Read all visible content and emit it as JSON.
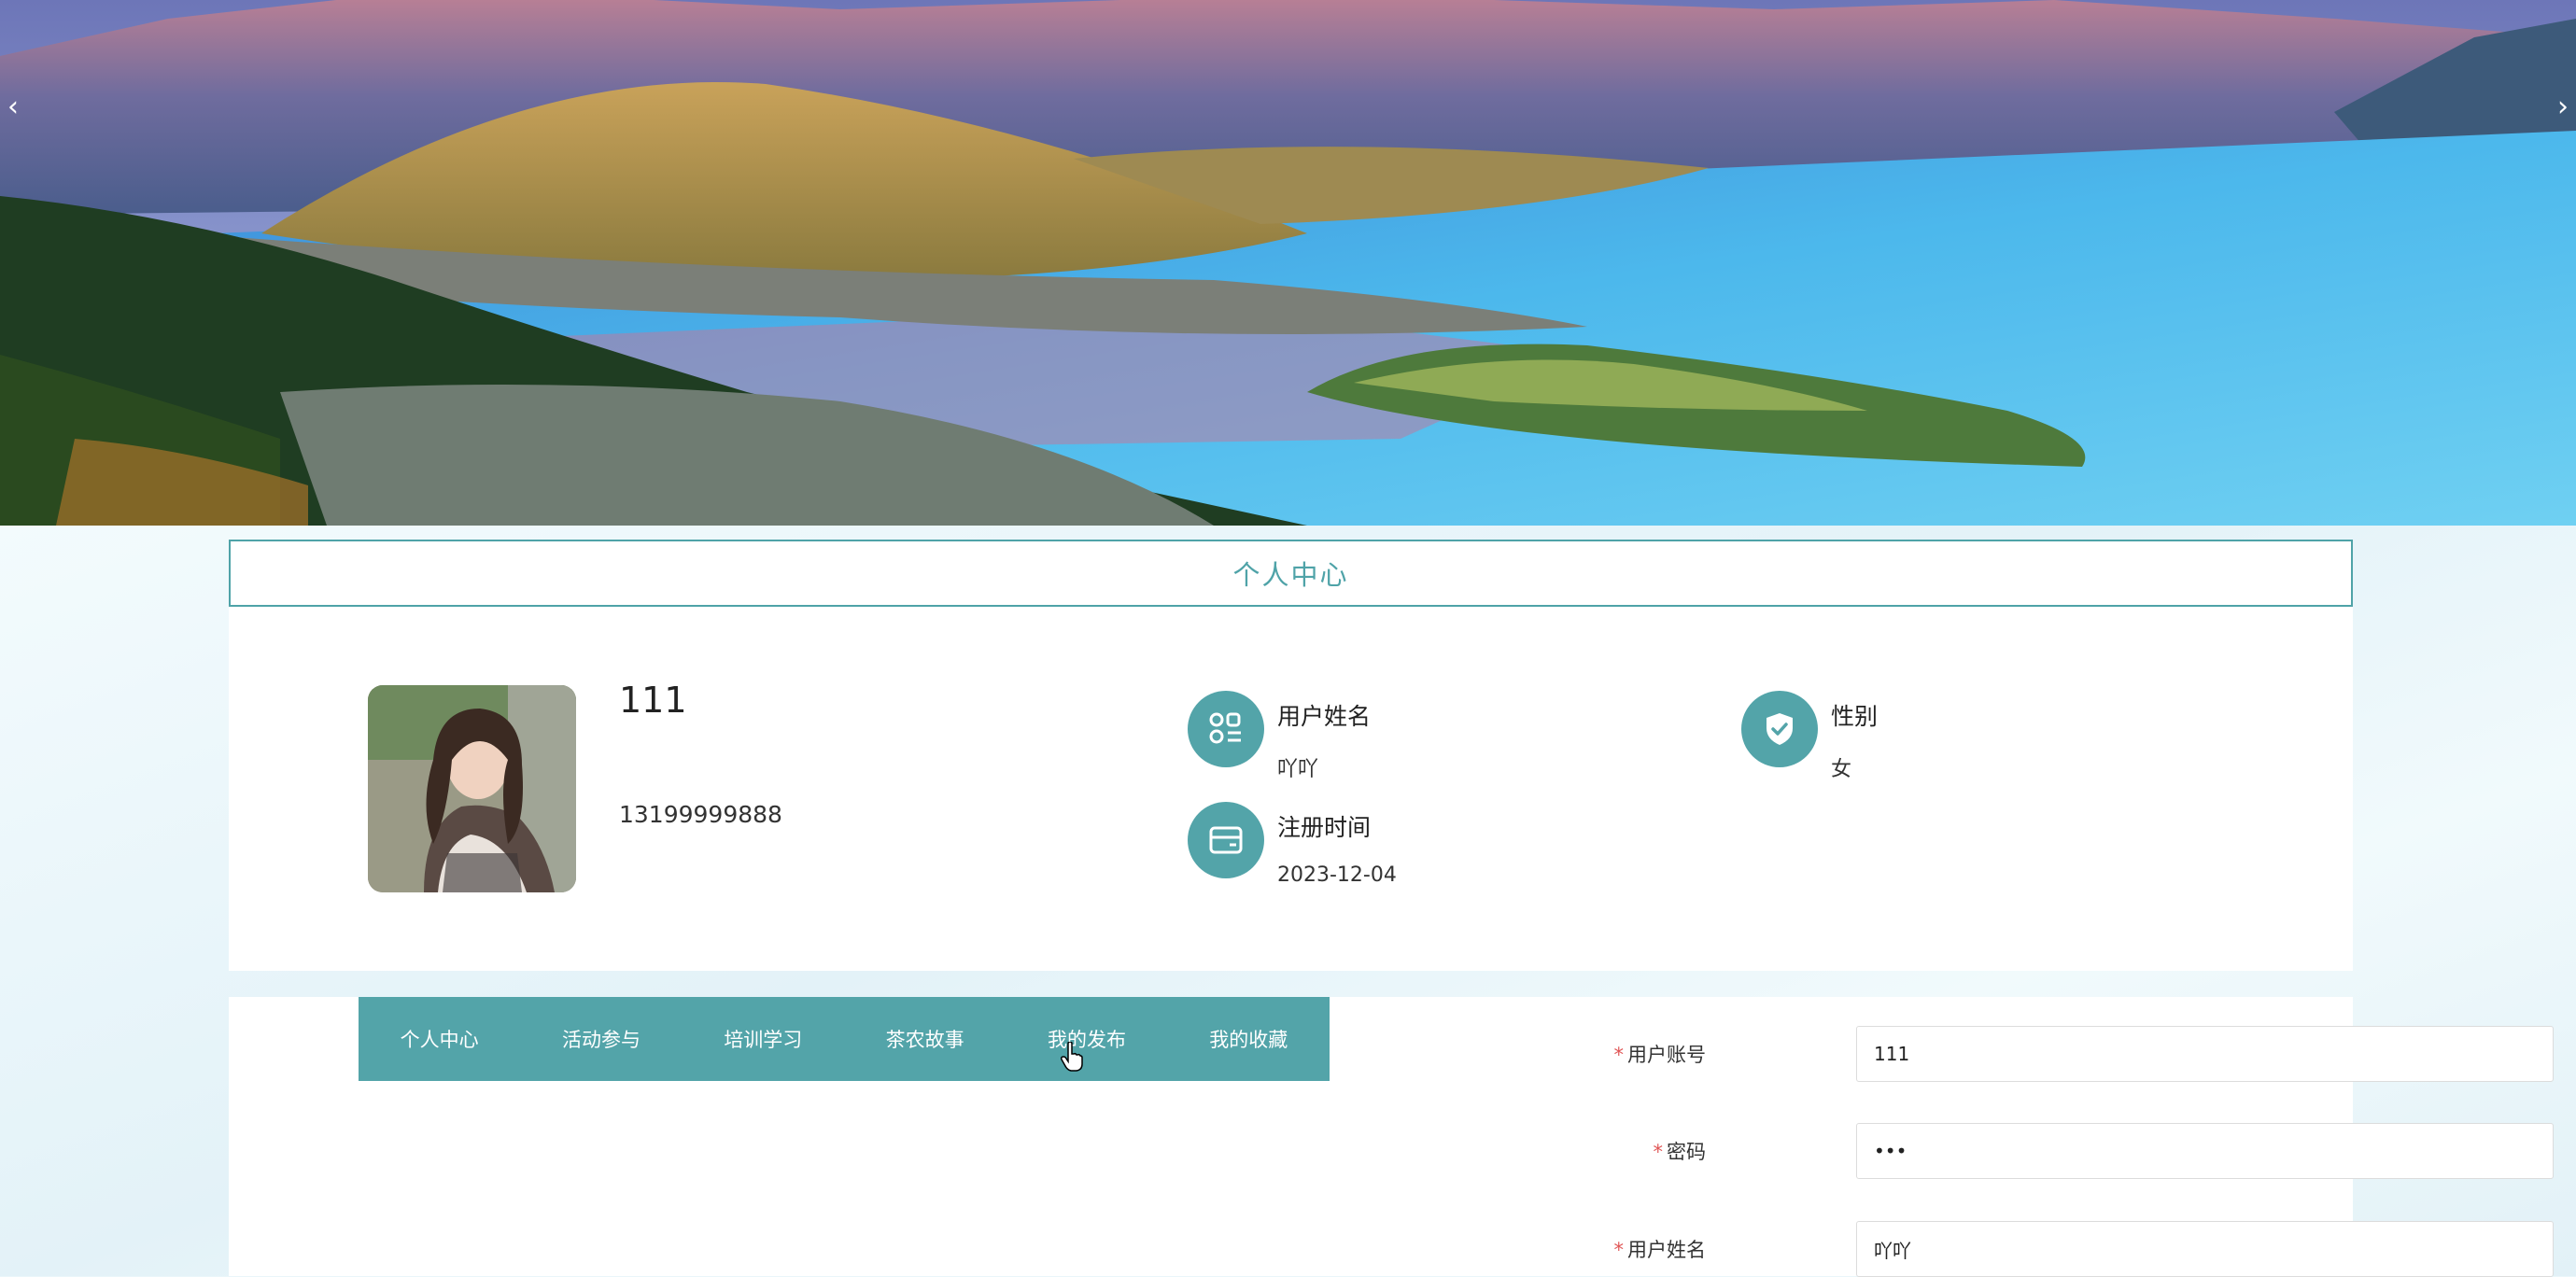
{
  "banner": {
    "prev_label": "‹",
    "next_label": "›"
  },
  "page": {
    "title": "个人中心"
  },
  "profile": {
    "name": "111",
    "phone": "13199999888",
    "fields": [
      {
        "label": "用户姓名",
        "value": "吖吖",
        "icon": "apps-list-icon"
      },
      {
        "label": "性别",
        "value": "女",
        "icon": "shield-check-icon"
      },
      {
        "label": "注册时间",
        "value": "2023-12-04",
        "icon": "card-icon"
      }
    ]
  },
  "tabs": [
    {
      "label": "个人中心"
    },
    {
      "label": "活动参与"
    },
    {
      "label": "培训学习"
    },
    {
      "label": "茶农故事"
    },
    {
      "label": "我的发布"
    },
    {
      "label": "我的收藏"
    }
  ],
  "form": {
    "required_mark": "*",
    "fields": [
      {
        "label": "用户账号",
        "value": "111"
      },
      {
        "label": "密码",
        "value": "•••"
      },
      {
        "label": "用户姓名",
        "value": "吖吖"
      }
    ]
  },
  "colors": {
    "accent": "#53a4a9",
    "required": "#e05555"
  }
}
